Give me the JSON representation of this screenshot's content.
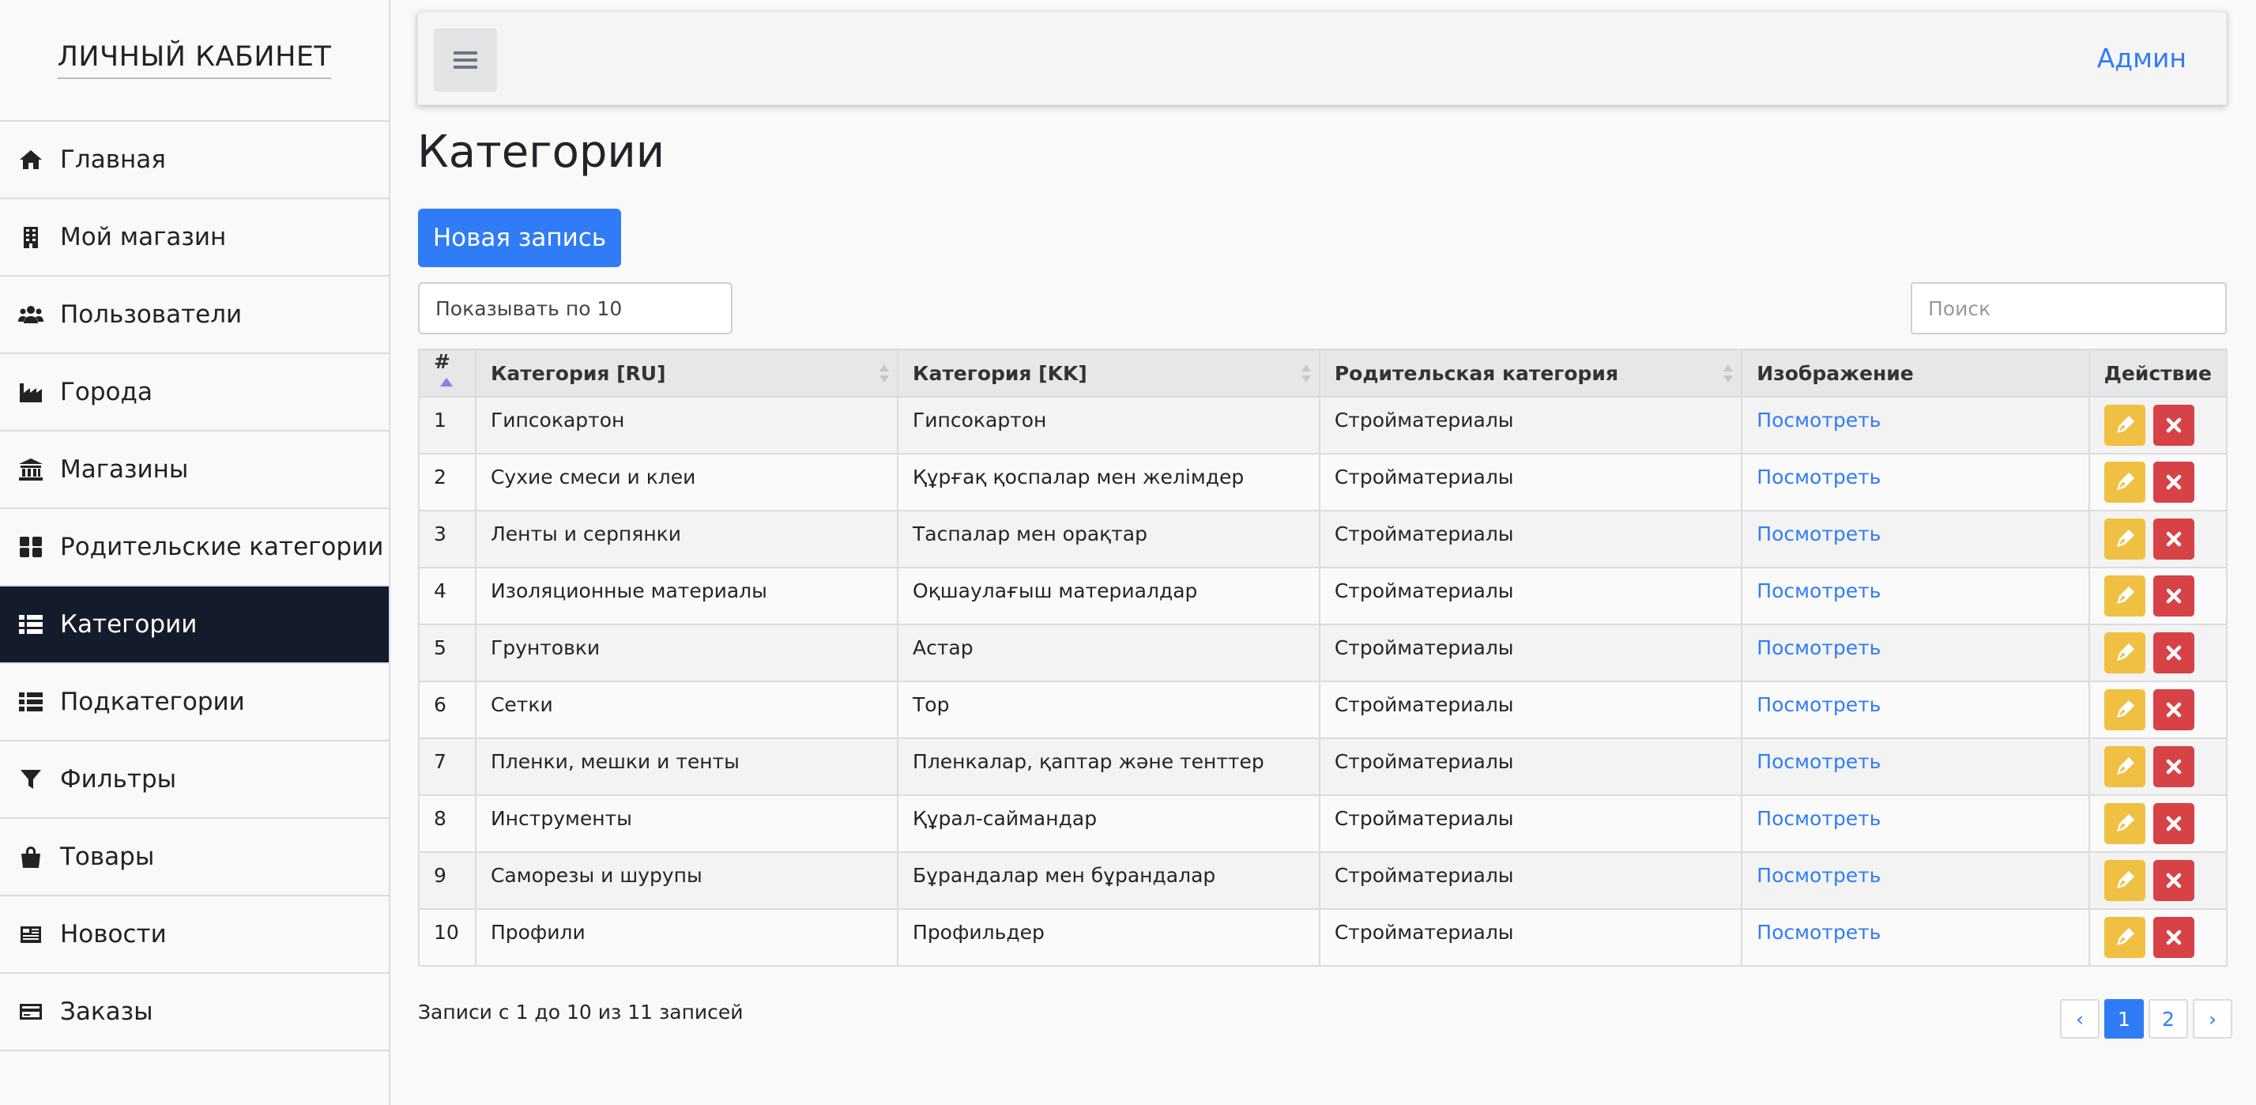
{
  "brand": "ЛИЧНЫЙ КАБИНЕТ",
  "colors": {
    "accent": "#2f7cf6",
    "sidebar_active": "#141b2a",
    "edit": "#f0c042",
    "delete": "#d64246"
  },
  "sidebar": {
    "items": [
      {
        "label": "Главная",
        "icon": "home-icon"
      },
      {
        "label": "Мой магазин",
        "icon": "building-icon"
      },
      {
        "label": "Пользователи",
        "icon": "users-icon"
      },
      {
        "label": "Города",
        "icon": "industry-icon"
      },
      {
        "label": "Магазины",
        "icon": "bank-icon"
      },
      {
        "label": "Родительские категории",
        "icon": "grid-icon"
      },
      {
        "label": "Категории",
        "icon": "list-icon",
        "active": true
      },
      {
        "label": "Подкатегории",
        "icon": "list-icon"
      },
      {
        "label": "Фильтры",
        "icon": "filter-icon"
      },
      {
        "label": "Товары",
        "icon": "shopping-bag-icon"
      },
      {
        "label": "Новости",
        "icon": "newspaper-icon"
      },
      {
        "label": "Заказы",
        "icon": "credit-card-icon"
      }
    ]
  },
  "header": {
    "user": "Админ",
    "menu_icon": "hamburger-icon"
  },
  "page": {
    "title": "Категории",
    "new_button": "Новая запись",
    "page_size": "Показывать по 10",
    "search_placeholder": "Поиск"
  },
  "table": {
    "columns": [
      "#",
      "Категория [RU]",
      "Категория [KK]",
      "Родительская категория",
      "Изображение",
      "Действие"
    ],
    "rows": [
      {
        "n": "1",
        "ru": "Гипсокартон",
        "kk": "Гипсокартон",
        "parent": "Стройматериалы",
        "image": "Посмотреть"
      },
      {
        "n": "2",
        "ru": "Сухие смеси и клеи",
        "kk": "Құрғақ қоспалар мен желімдер",
        "parent": "Стройматериалы",
        "image": "Посмотреть"
      },
      {
        "n": "3",
        "ru": "Ленты и серпянки",
        "kk": "Таспалар мен орақтар",
        "parent": "Стройматериалы",
        "image": "Посмотреть"
      },
      {
        "n": "4",
        "ru": "Изоляционные материалы",
        "kk": "Оқшаулағыш материалдар",
        "parent": "Стройматериалы",
        "image": "Посмотреть"
      },
      {
        "n": "5",
        "ru": "Грунтовки",
        "kk": "Астар",
        "parent": "Стройматериалы",
        "image": "Посмотреть"
      },
      {
        "n": "6",
        "ru": "Сетки",
        "kk": "Тор",
        "parent": "Стройматериалы",
        "image": "Посмотреть"
      },
      {
        "n": "7",
        "ru": "Пленки, мешки и тенты",
        "kk": "Пленкалар, қаптар және тенттер",
        "parent": "Стройматериалы",
        "image": "Посмотреть"
      },
      {
        "n": "8",
        "ru": "Инструменты",
        "kk": "Құрал-саймандар",
        "parent": "Стройматериалы",
        "image": "Посмотреть"
      },
      {
        "n": "9",
        "ru": "Саморезы и шурупы",
        "kk": "Бұрандалар мен бұрандалар",
        "parent": "Стройматериалы",
        "image": "Посмотреть"
      },
      {
        "n": "10",
        "ru": "Профили",
        "kk": "Профильдер",
        "parent": "Стройматериалы",
        "image": "Посмотреть"
      }
    ]
  },
  "footer": {
    "info": "Записи с 1 до 10 из 11 записей",
    "pagination": {
      "prev": "‹",
      "pages": [
        "1",
        "2"
      ],
      "current": "1",
      "next": "›"
    }
  }
}
